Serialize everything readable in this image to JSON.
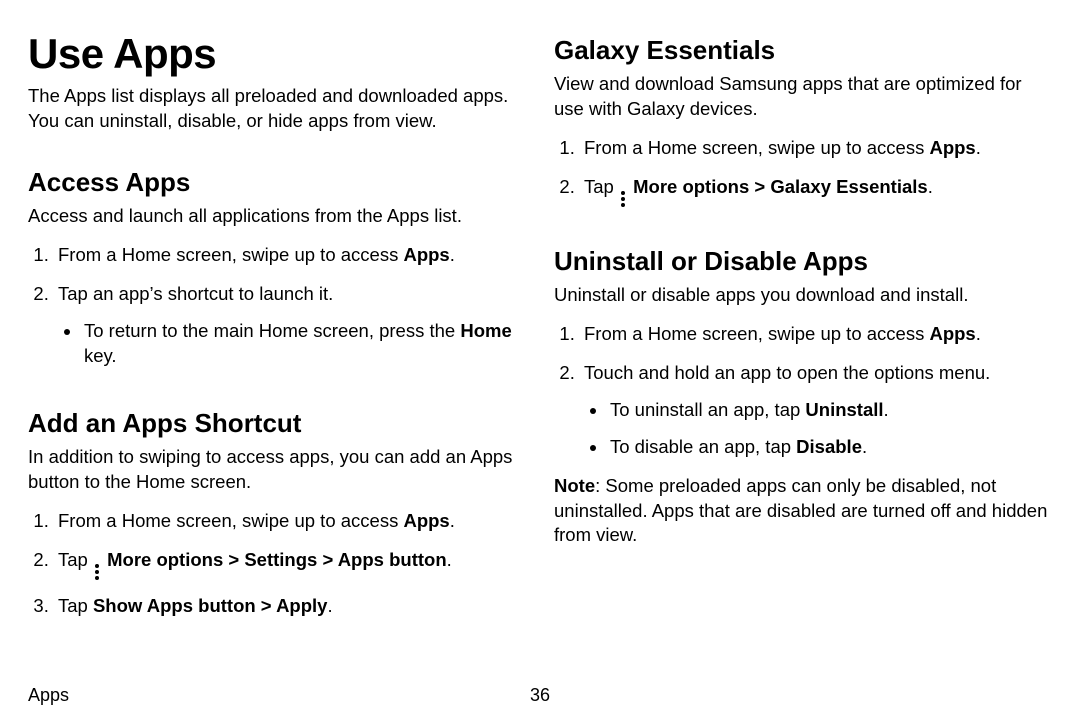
{
  "page": {
    "title": "Use Apps",
    "intro": "The Apps list displays all preloaded and downloaded apps. You can uninstall, disable, or hide apps from view."
  },
  "access": {
    "heading": "Access Apps",
    "intro": "Access and launch all applications from the Apps list.",
    "step1_pre": "From a Home screen, swipe up to access ",
    "step1_bold": "Apps",
    "step1_post": ".",
    "step2": "Tap an app’s shortcut to launch it.",
    "sub_pre": "To return to the main Home screen, press the ",
    "sub_bold": "Home",
    "sub_post": " key."
  },
  "shortcut": {
    "heading": "Add an Apps Shortcut",
    "intro": "In addition to swiping to access apps, you can add an Apps button to the Home screen.",
    "step1_pre": "From a Home screen, swipe up to access ",
    "step1_bold": "Apps",
    "step1_post": ".",
    "step2_pre": "Tap ",
    "step2_bold": "More options > Settings > Apps button",
    "step2_post": ".",
    "step3_pre": "Tap ",
    "step3_bold": "Show Apps button > Apply",
    "step3_post": "."
  },
  "galaxy": {
    "heading": "Galaxy Essentials",
    "intro": "View and download Samsung apps that are optimized for use with Galaxy devices.",
    "step1_pre": "From a Home screen, swipe up to access ",
    "step1_bold": "Apps",
    "step1_post": ".",
    "step2_pre": "Tap ",
    "step2_bold": "More options > Galaxy Essentials",
    "step2_post": "."
  },
  "uninstall": {
    "heading": "Uninstall or Disable Apps",
    "intro": "Uninstall or disable apps you download and install.",
    "step1_pre": "From a Home screen, swipe up to access ",
    "step1_bold": "Apps",
    "step1_post": ".",
    "step2": "Touch and hold an app to open the options menu.",
    "sub1_pre": "To uninstall an app, tap ",
    "sub1_bold": "Uninstall",
    "sub1_post": ".",
    "sub2_pre": "To disable an app, tap ",
    "sub2_bold": "Disable",
    "sub2_post": ".",
    "note_label": "Note",
    "note_body": ": Some preloaded apps can only be disabled, not uninstalled. Apps that are disabled are turned off and hidden from view."
  },
  "footer": {
    "section": "Apps",
    "page_number": "36"
  }
}
